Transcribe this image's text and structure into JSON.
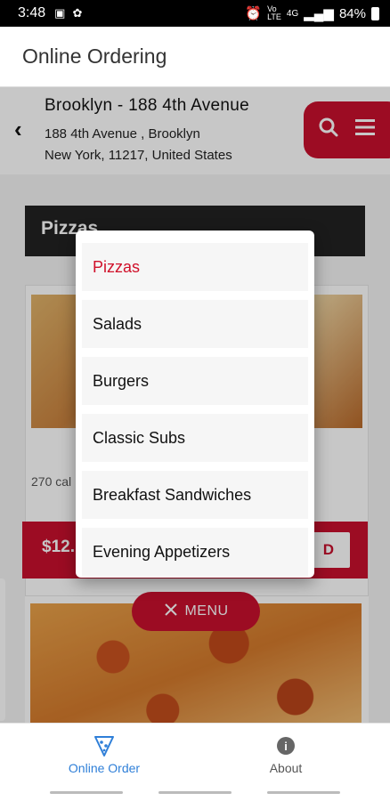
{
  "status_bar": {
    "time": "3:48",
    "battery": "84%",
    "icons": [
      "image-icon",
      "notification-icon",
      "alarm-icon",
      "volte-icon",
      "4g-icon",
      "signal-icon",
      "battery-icon"
    ]
  },
  "app_header": {
    "title": "Online Ordering"
  },
  "store": {
    "name": "Brooklyn - 188 4th Avenue",
    "address_line1": "188 4th Avenue , Brooklyn",
    "address_line2": "New York, 11217, United States"
  },
  "category": {
    "heading": "Pizzas"
  },
  "item": {
    "calories": "270 cal",
    "price": "$12.",
    "add_label": "D"
  },
  "menu_button": {
    "label": "MENU"
  },
  "dropdown": {
    "items": [
      {
        "label": "Pizzas",
        "active": true
      },
      {
        "label": "Salads",
        "active": false
      },
      {
        "label": "Burgers",
        "active": false
      },
      {
        "label": "Classic Subs",
        "active": false
      },
      {
        "label": "Breakfast Sandwiches",
        "active": false
      },
      {
        "label": "Evening Appetizers",
        "active": false
      }
    ]
  },
  "bottom_nav": {
    "items": [
      {
        "label": "Online Order",
        "icon": "pizza-slice-icon",
        "active": true
      },
      {
        "label": "About",
        "icon": "info-icon",
        "active": false
      }
    ]
  },
  "colors": {
    "brand": "#c8102e",
    "active_nav": "#2f7fd8",
    "active_item": "#d0102a"
  }
}
